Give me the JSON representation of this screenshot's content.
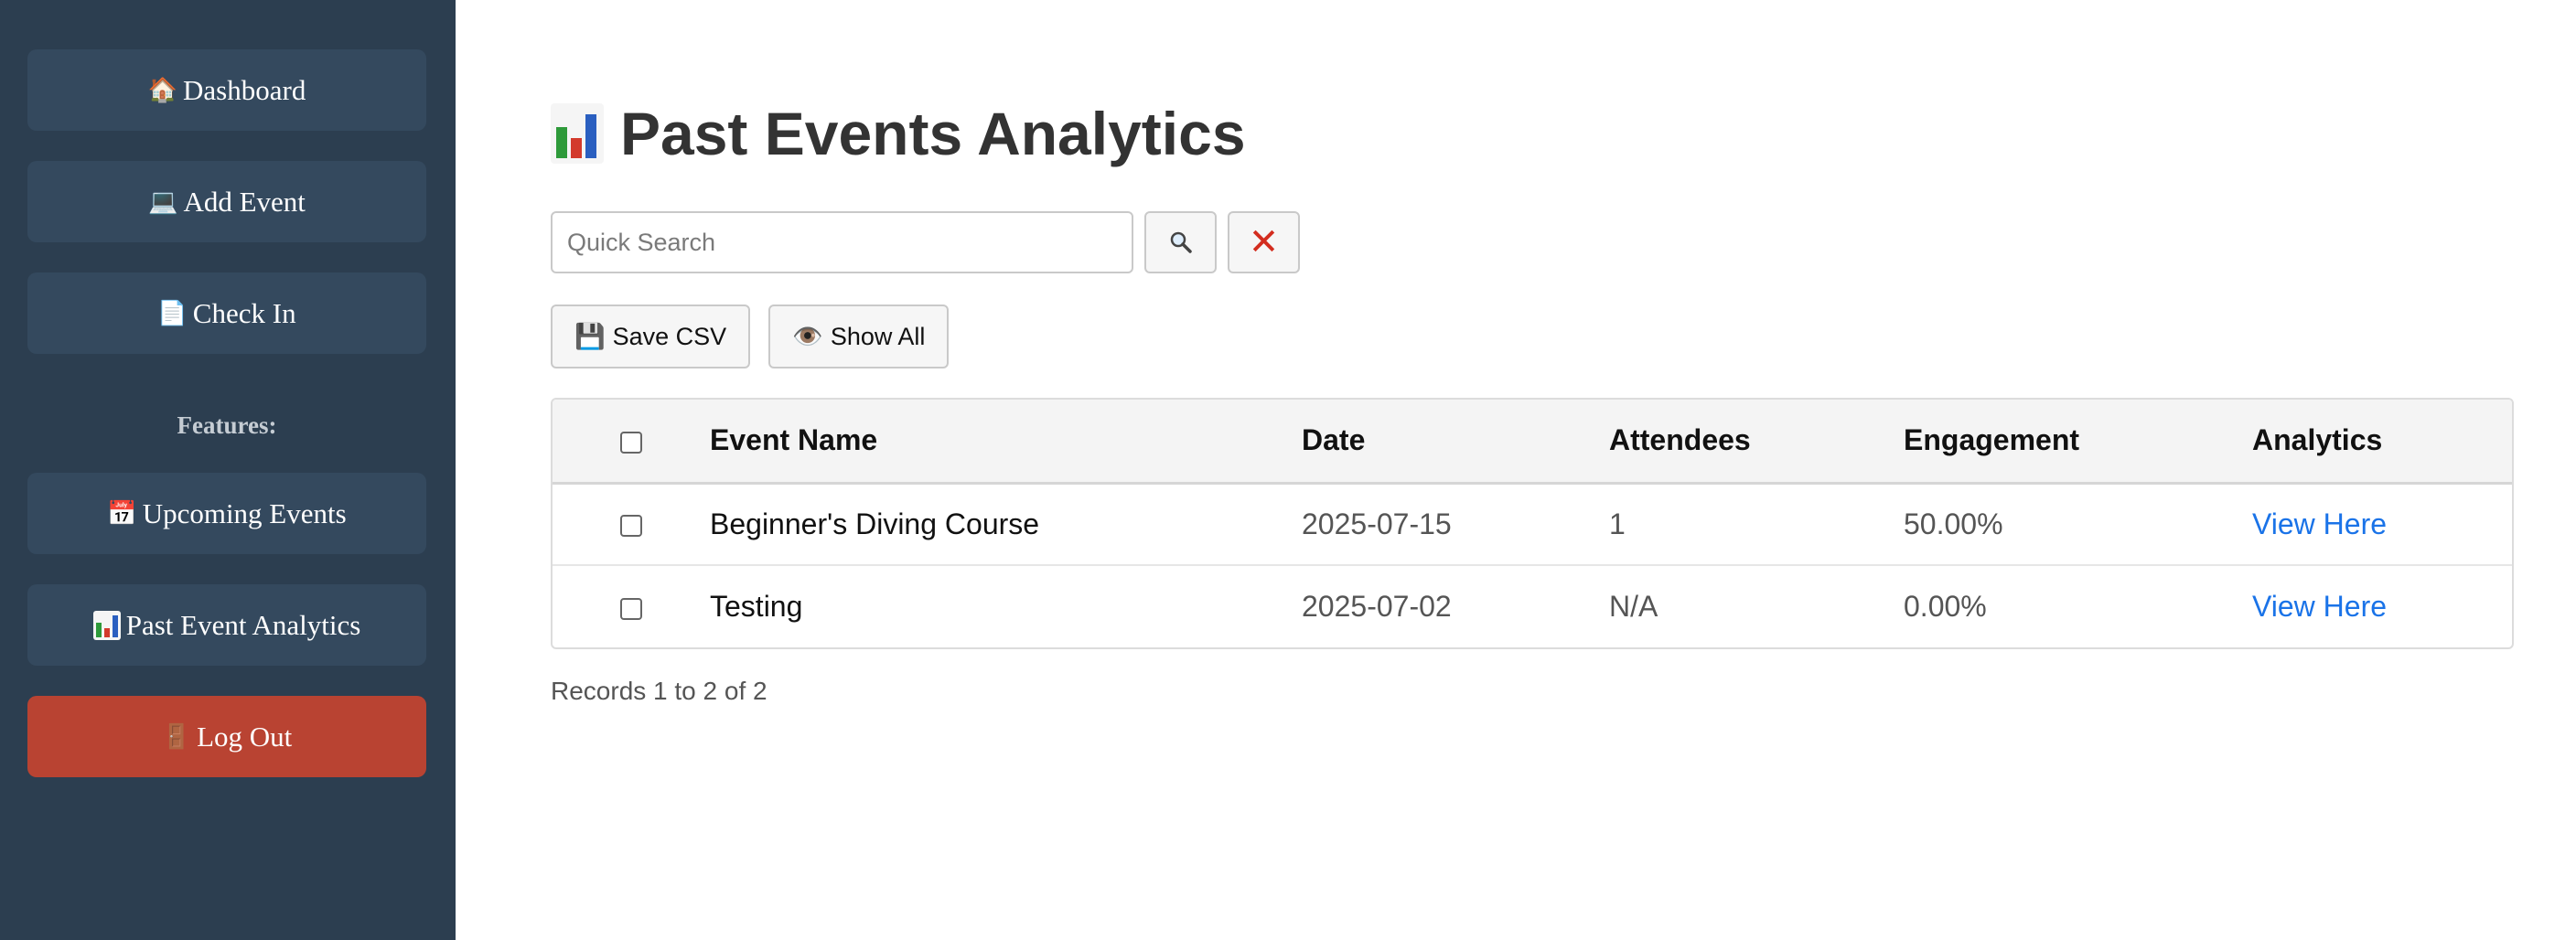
{
  "sidebar": {
    "items": [
      {
        "icon": "🏠",
        "label": "Dashboard"
      },
      {
        "icon": "💻",
        "label": "Add Event"
      },
      {
        "icon": "📄",
        "label": "Check In"
      }
    ],
    "features_label": "Features:",
    "feature_items": [
      {
        "icon": "📅",
        "label": "Upcoming Events"
      },
      {
        "icon": "chart-icon",
        "label": "Past Event Analytics"
      }
    ],
    "logout": {
      "icon": "🚪",
      "label": "Log Out"
    }
  },
  "page": {
    "title_icon": "chart-icon",
    "title": "Past Events Analytics"
  },
  "search": {
    "placeholder": "Quick Search",
    "value": "",
    "search_icon": "🔍",
    "clear_icon": "✕"
  },
  "actions": {
    "save_csv": {
      "icon": "💾",
      "label": "Save CSV"
    },
    "show_all": {
      "icon": "👁️",
      "label": "Show All"
    }
  },
  "table": {
    "headers": [
      "Event Name",
      "Date",
      "Attendees",
      "Engagement",
      "Analytics"
    ],
    "rows": [
      {
        "name": "Beginner's Diving Course",
        "date": "2025-07-15",
        "attendees": "1",
        "engagement": "50.00%",
        "analytics": "View Here"
      },
      {
        "name": "Testing",
        "date": "2025-07-02",
        "attendees": "N/A",
        "engagement": "0.00%",
        "analytics": "View Here"
      }
    ]
  },
  "records_text": "Records 1 to 2 of 2",
  "colors": {
    "sidebar_bg": "#2c3e50",
    "nav_btn_bg": "#34495e",
    "logout_bg": "#b94332",
    "link": "#1a73e8",
    "clear_icon": "#d32d1f"
  }
}
